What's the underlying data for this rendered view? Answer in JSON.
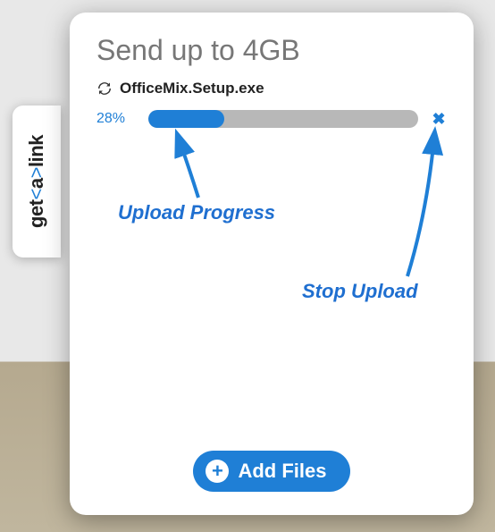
{
  "sidebar": {
    "brand_pre": "get",
    "brand_lt": "<",
    "brand_a": "a",
    "brand_gt": ">",
    "brand_post": "link"
  },
  "card": {
    "title": "Send up to 4GB",
    "file": {
      "name": "OfficeMix.Setup.exe",
      "percent_label": "28%",
      "percent_value": 28
    },
    "add_button_label": "Add Files"
  },
  "annotations": {
    "upload_progress": "Upload Progress",
    "stop_upload": "Stop Upload"
  },
  "colors": {
    "accent": "#1f7fd6"
  }
}
